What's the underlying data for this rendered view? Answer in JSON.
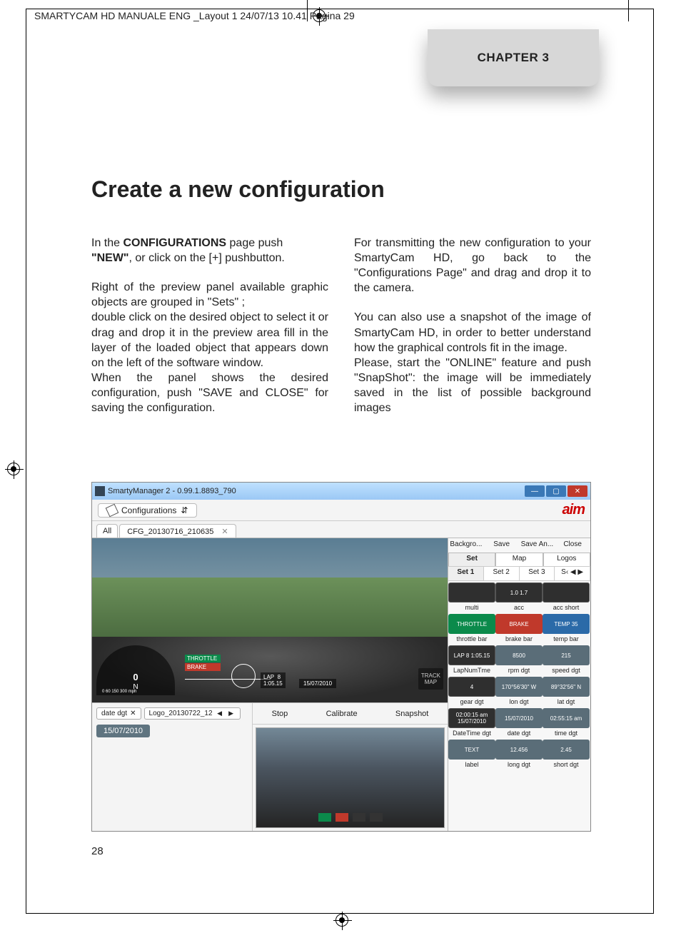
{
  "filepath": "SMARTYCAM HD MANUALE ENG _Layout 1  24/07/13  10.41  Pagina 29",
  "chapter_tab": "CHAPTER 3",
  "heading": "Create a new configuration",
  "col1": {
    "p1a": "In the ",
    "p1b": "CONFIGURATIONS",
    "p1c": " page push ",
    "p1d": "\"NEW\"",
    "p1e": ", or click on the  [+] pushbutton.",
    "p2": "Right of the preview panel available graphic objects are grouped in \"Sets\" ;",
    "p3": "double click on the desired object  to select it or drag and drop it in the preview area fill in the layer of the loaded object that appears down on the left of the software window.",
    "p4": "When the panel shows the desired configuration, push \"SAVE and CLOSE\" for saving the configuration."
  },
  "col2": {
    "p1": "For transmitting the new configuration to your SmartyCam HD, go back to the \"Configurations Page\" and drag and drop it to the camera.",
    "p2": "You can also use a snapshot of the image of SmartyCam HD, in order to better understand how the graphical controls fit in the image.",
    "p3": "Please, start the \"ONLINE\" feature and push \"SnapShot\": the image will be immediately saved in the list of possible background images"
  },
  "window": {
    "title": "SmartyManager 2 - 0.99.1.8893_790",
    "configurations_btn": "Configurations",
    "tab_all": "All",
    "tab_cfg": "CFG_20130716_210635",
    "logo": "aim",
    "overlay": {
      "throttle": "THROTTLE",
      "brake": "BRAKE",
      "lap_label": "LAP",
      "lap_num": "8",
      "lap_time": "1:05.15",
      "date": "15/07/2010",
      "zero": "0",
      "speed_small": "0  60    150    300 mph",
      "n": "N",
      "trackmap1": "TRACK",
      "trackmap2": "MAP"
    },
    "layer": {
      "date_dgt": "date dgt",
      "logo_layer": "Logo_20130722_12",
      "date_val": "15/07/2010"
    },
    "snap": {
      "stop": "Stop",
      "calibrate": "Calibrate",
      "snapshot": "Snapshot"
    },
    "sets": {
      "head": [
        "Backgro...",
        "Save",
        "Save An...",
        "Close"
      ],
      "sub": [
        "Set",
        "Map",
        "Logos"
      ],
      "setrow": [
        "Set 1",
        "Set 2",
        "Set 3",
        "S‹ ◀ ▶"
      ],
      "row1": [
        {
          "img": "dark",
          "lbl": "multi",
          "txt": ""
        },
        {
          "img": "dark",
          "lbl": "acc",
          "txt": "1.0\n1.7"
        },
        {
          "img": "dark",
          "lbl": "acc short",
          "txt": ""
        }
      ],
      "row2": [
        {
          "img": "green",
          "lbl": "throttle bar",
          "txt": "THROTTLE"
        },
        {
          "img": "red",
          "lbl": "brake bar",
          "txt": "BRAKE"
        },
        {
          "img": "blue",
          "lbl": "temp bar",
          "txt": "TEMP 35"
        }
      ],
      "row3": [
        {
          "img": "dark",
          "lbl": "LapNumTme",
          "txt": "LAP 8\n1:05.15"
        },
        {
          "img": "grey",
          "lbl": "rpm dgt",
          "txt": "8500"
        },
        {
          "img": "grey",
          "lbl": "speed dgt",
          "txt": "215"
        }
      ],
      "row4": [
        {
          "img": "dark",
          "lbl": "gear dgt",
          "txt": "4"
        },
        {
          "img": "grey",
          "lbl": "lon dgt",
          "txt": "170°56'30\" W"
        },
        {
          "img": "grey",
          "lbl": "lat dgt",
          "txt": "89°32'56\" N"
        }
      ],
      "row5": [
        {
          "img": "dark",
          "lbl": "DateTime dgt",
          "txt": "02:00:15 am 15/07/2010"
        },
        {
          "img": "grey",
          "lbl": "date dgt",
          "txt": "15/07/2010"
        },
        {
          "img": "grey",
          "lbl": "time dgt",
          "txt": "02:55:15 am"
        }
      ],
      "row6": [
        {
          "img": "grey",
          "lbl": "label",
          "txt": "TEXT"
        },
        {
          "img": "grey",
          "lbl": "long dgt",
          "txt": "12.456"
        },
        {
          "img": "grey",
          "lbl": "short dgt",
          "txt": "2.45"
        }
      ]
    }
  },
  "page_number": "28"
}
